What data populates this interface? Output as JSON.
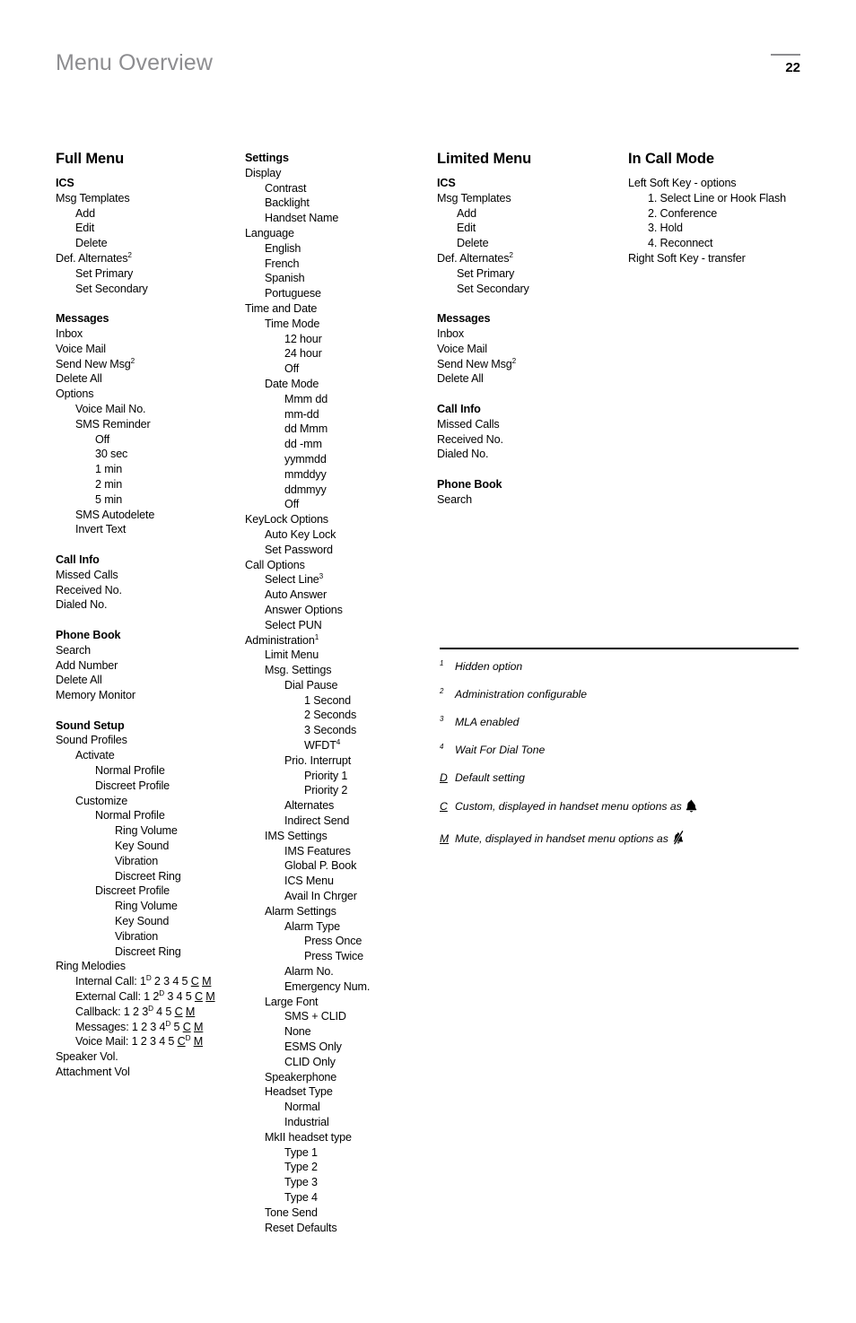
{
  "header": {
    "title": "Menu Overview",
    "page_number": "22"
  },
  "columns": {
    "full_menu": {
      "title": "Full Menu",
      "blocks": [
        {
          "head": "ICS",
          "items": [
            {
              "label": "Msg Templates",
              "level": 0
            },
            {
              "label": "Add",
              "level": 1
            },
            {
              "label": "Edit",
              "level": 1
            },
            {
              "label": "Delete",
              "level": 1
            },
            {
              "label": "Def. Alternates",
              "level": 0,
              "sup": "2"
            },
            {
              "label": "Set Primary",
              "level": 1
            },
            {
              "label": "Set Secondary",
              "level": 1
            }
          ]
        },
        {
          "head": "Messages",
          "items": [
            {
              "label": "Inbox",
              "level": 0
            },
            {
              "label": "Voice Mail",
              "level": 0
            },
            {
              "label": "Send New Msg",
              "level": 0,
              "sup": "2"
            },
            {
              "label": "Delete All",
              "level": 0
            },
            {
              "label": "Options",
              "level": 0
            },
            {
              "label": "Voice Mail No.",
              "level": 1
            },
            {
              "label": "SMS Reminder",
              "level": 1
            },
            {
              "label": "Off",
              "level": 2
            },
            {
              "label": "30 sec",
              "level": 2
            },
            {
              "label": "1 min",
              "level": 2
            },
            {
              "label": "2 min",
              "level": 2
            },
            {
              "label": "5 min",
              "level": 2
            },
            {
              "label": "SMS Autodelete",
              "level": 1
            },
            {
              "label": "Invert Text",
              "level": 1
            }
          ]
        },
        {
          "head": "Call Info",
          "items": [
            {
              "label": "Missed Calls",
              "level": 0
            },
            {
              "label": "Received No.",
              "level": 0
            },
            {
              "label": "Dialed No.",
              "level": 0
            }
          ]
        },
        {
          "head": "Phone Book",
          "items": [
            {
              "label": "Search",
              "level": 0
            },
            {
              "label": "Add Number",
              "level": 0
            },
            {
              "label": "Delete All",
              "level": 0
            },
            {
              "label": "Memory Monitor",
              "level": 0
            }
          ]
        },
        {
          "head": "Sound Setup",
          "items": [
            {
              "label": "Sound Profiles",
              "level": 0
            },
            {
              "label": "Activate",
              "level": 1
            },
            {
              "label": "Normal Profile",
              "level": 2
            },
            {
              "label": "Discreet Profile",
              "level": 2
            },
            {
              "label": "Customize",
              "level": 1
            },
            {
              "label": "Normal Profile",
              "level": 2
            },
            {
              "label": "Ring Volume",
              "level": 3
            },
            {
              "label": "Key Sound",
              "level": 3
            },
            {
              "label": "Vibration",
              "level": 3
            },
            {
              "label": "Discreet Ring",
              "level": 3
            },
            {
              "label": "Discreet Profile",
              "level": 2
            },
            {
              "label": "Ring Volume",
              "level": 3
            },
            {
              "label": "Key Sound",
              "level": 3
            },
            {
              "label": "Vibration",
              "level": 3
            },
            {
              "label": "Discreet Ring",
              "level": 3
            },
            {
              "label": "Ring Melodies",
              "level": 0
            },
            {
              "label": "Internal Call: 1",
              "level": 1,
              "melody": true,
              "sup": "D",
              "after": " 2 3 4 5 ",
              "underlined": [
                "C",
                "M"
              ]
            },
            {
              "label": "External Call: 1 2",
              "level": 1,
              "melody": true,
              "sup": "D",
              "after": " 3 4 5 ",
              "underlined": [
                "C",
                "M"
              ]
            },
            {
              "label": "Callback: 1 2 3",
              "level": 1,
              "melody": true,
              "sup": "D",
              "after": " 4 5 ",
              "underlined": [
                "C",
                "M"
              ]
            },
            {
              "label": "Messages: 1 2 3 4",
              "level": 1,
              "melody": true,
              "sup": "D",
              "after": " 5 ",
              "underlined": [
                "C",
                "M"
              ]
            },
            {
              "label": "Voice Mail: 1 2 3 4 5 ",
              "level": 1,
              "melody": true,
              "supAfterC": "D",
              "underlined": [
                "C",
                "M"
              ]
            },
            {
              "label": "Speaker Vol.",
              "level": 0
            },
            {
              "label": "Attachment Vol",
              "level": 0
            }
          ]
        }
      ]
    },
    "settings": {
      "title": "",
      "blocks": [
        {
          "head": "Settings",
          "items": [
            {
              "label": "Display",
              "level": 0
            },
            {
              "label": "Contrast",
              "level": 1
            },
            {
              "label": "Backlight",
              "level": 1
            },
            {
              "label": "Handset Name",
              "level": 1
            },
            {
              "label": "Language",
              "level": 0
            },
            {
              "label": "English",
              "level": 1
            },
            {
              "label": "French",
              "level": 1
            },
            {
              "label": "Spanish",
              "level": 1
            },
            {
              "label": "Portuguese",
              "level": 1
            },
            {
              "label": "Time and Date",
              "level": 0
            },
            {
              "label": "Time Mode",
              "level": 1
            },
            {
              "label": "12 hour",
              "level": 2
            },
            {
              "label": "24 hour",
              "level": 2
            },
            {
              "label": "Off",
              "level": 2
            },
            {
              "label": "Date Mode",
              "level": 1
            },
            {
              "label": "Mmm dd",
              "level": 2
            },
            {
              "label": "mm-dd",
              "level": 2
            },
            {
              "label": "dd Mmm",
              "level": 2
            },
            {
              "label": "dd -mm",
              "level": 2
            },
            {
              "label": "yymmdd",
              "level": 2
            },
            {
              "label": "mmddyy",
              "level": 2
            },
            {
              "label": "ddmmyy",
              "level": 2
            },
            {
              "label": "Off",
              "level": 2
            },
            {
              "label": "KeyLock Options",
              "level": 0
            },
            {
              "label": "Auto Key Lock",
              "level": 1
            },
            {
              "label": "Set Password",
              "level": 1
            },
            {
              "label": "Call Options",
              "level": 0
            },
            {
              "label": "Select Line",
              "level": 1,
              "sup": "3"
            },
            {
              "label": "Auto Answer",
              "level": 1
            },
            {
              "label": "Answer Options",
              "level": 1
            },
            {
              "label": "Select PUN",
              "level": 1
            },
            {
              "label": "Administration",
              "level": 0,
              "sup": "1"
            },
            {
              "label": "Limit Menu",
              "level": 1
            },
            {
              "label": "Msg. Settings",
              "level": 1
            },
            {
              "label": "Dial Pause",
              "level": 2
            },
            {
              "label": "1 Second",
              "level": 3
            },
            {
              "label": "2 Seconds",
              "level": 3
            },
            {
              "label": "3 Seconds",
              "level": 3
            },
            {
              "label": "WFDT",
              "level": 3,
              "sup": "4"
            },
            {
              "label": "Prio. Interrupt",
              "level": 2
            },
            {
              "label": "Priority 1",
              "level": 3
            },
            {
              "label": "Priority 2",
              "level": 3
            },
            {
              "label": "Alternates",
              "level": 2
            },
            {
              "label": "Indirect Send",
              "level": 2
            },
            {
              "label": "IMS Settings",
              "level": 1
            },
            {
              "label": "IMS Features",
              "level": 2
            },
            {
              "label": "Global P. Book",
              "level": 2
            },
            {
              "label": "ICS Menu",
              "level": 2
            },
            {
              "label": "Avail In Chrger",
              "level": 2
            },
            {
              "label": "Alarm Settings",
              "level": 1
            },
            {
              "label": "Alarm Type",
              "level": 2
            },
            {
              "label": "Press Once",
              "level": 3
            },
            {
              "label": "Press Twice",
              "level": 3
            },
            {
              "label": "Alarm No.",
              "level": 2
            },
            {
              "label": "Emergency Num.",
              "level": 2
            },
            {
              "label": "Large Font",
              "level": 1
            },
            {
              "label": "SMS + CLID",
              "level": 2
            },
            {
              "label": "None",
              "level": 2
            },
            {
              "label": "ESMS Only",
              "level": 2
            },
            {
              "label": "CLID Only",
              "level": 2
            },
            {
              "label": "Speakerphone",
              "level": 1
            },
            {
              "label": "Headset Type",
              "level": 1
            },
            {
              "label": "Normal",
              "level": 2
            },
            {
              "label": "Industrial",
              "level": 2
            },
            {
              "label": "MkII headset type",
              "level": 1
            },
            {
              "label": "Type 1",
              "level": 2
            },
            {
              "label": "Type 2",
              "level": 2
            },
            {
              "label": "Type 3",
              "level": 2
            },
            {
              "label": "Type 4",
              "level": 2
            },
            {
              "label": "Tone Send",
              "level": 1
            },
            {
              "label": "Reset Defaults",
              "level": 1
            }
          ]
        }
      ]
    },
    "limited_menu": {
      "title": "Limited Menu",
      "blocks": [
        {
          "head": "ICS",
          "items": [
            {
              "label": "Msg Templates",
              "level": 0
            },
            {
              "label": "Add",
              "level": 1
            },
            {
              "label": "Edit",
              "level": 1
            },
            {
              "label": "Delete",
              "level": 1
            },
            {
              "label": "Def. Alternates",
              "level": 0,
              "sup": "2"
            },
            {
              "label": "Set Primary",
              "level": 1
            },
            {
              "label": "Set Secondary",
              "level": 1
            }
          ]
        },
        {
          "head": "Messages",
          "items": [
            {
              "label": "Inbox",
              "level": 0
            },
            {
              "label": "Voice Mail",
              "level": 0
            },
            {
              "label": "Send New Msg",
              "level": 0,
              "sup": "2"
            },
            {
              "label": "Delete All",
              "level": 0
            }
          ]
        },
        {
          "head": "Call Info",
          "items": [
            {
              "label": "Missed Calls",
              "level": 0
            },
            {
              "label": "Received No.",
              "level": 0
            },
            {
              "label": "Dialed No.",
              "level": 0
            }
          ]
        },
        {
          "head": "Phone Book",
          "items": [
            {
              "label": "Search",
              "level": 0
            }
          ]
        }
      ]
    },
    "in_call_mode": {
      "title": "In Call Mode",
      "items": [
        {
          "label": "Left Soft Key - options",
          "level": 0
        },
        {
          "label": "1. Select Line or Hook Flash",
          "level": 1
        },
        {
          "label": "2. Conference",
          "level": 1
        },
        {
          "label": "3. Hold",
          "level": 1
        },
        {
          "label": "4. Reconnect",
          "level": 1
        },
        {
          "label": "Right Soft Key - transfer",
          "level": 0
        }
      ]
    }
  },
  "notes": {
    "footnotes": [
      {
        "marker": "1",
        "text": "Hidden option"
      },
      {
        "marker": "2",
        "text": "Administration configurable"
      },
      {
        "marker": "3",
        "text": "MLA enabled"
      },
      {
        "marker": "4",
        "text": "Wait For Dial Tone"
      }
    ],
    "legend": [
      {
        "marker": "D",
        "text": "Default setting",
        "icon": ""
      },
      {
        "marker": "C",
        "text": "Custom, displayed in handset menu options as",
        "icon": "bell-icon"
      },
      {
        "marker": "M",
        "text": "Mute, displayed in handset menu options as",
        "icon": "bell-muted-icon"
      }
    ]
  }
}
